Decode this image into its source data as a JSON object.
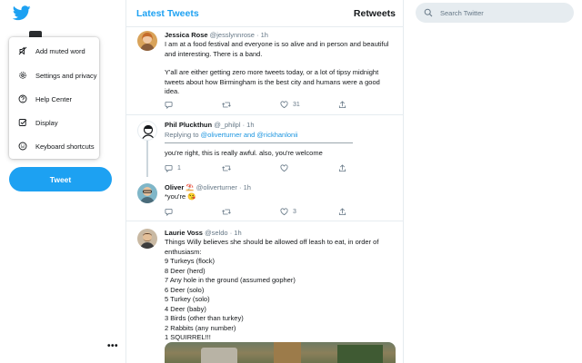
{
  "colors": {
    "accent": "#1da1f2",
    "link": "#1b95e0",
    "muted": "#657786",
    "border": "#e6ecf0"
  },
  "nav": {
    "logo_icon": "twitter-bird-icon",
    "menu": [
      {
        "label": "Add muted word",
        "icon": "mute-icon"
      },
      {
        "label": "Settings and privacy",
        "icon": "gear-icon"
      },
      {
        "label": "Help Center",
        "icon": "help-icon"
      },
      {
        "label": "Display",
        "icon": "display-icon"
      },
      {
        "label": "Keyboard shortcuts",
        "icon": "keyboard-icon"
      }
    ],
    "tweet_button": "Tweet",
    "more": "•••"
  },
  "header": {
    "title": "Latest Tweets",
    "retweets": "Retweets"
  },
  "search": {
    "placeholder": "Search Twitter"
  },
  "tweets": [
    {
      "name": "Jessica Rose",
      "handle": "@jesslynnrose · 1h",
      "text_p1": "I am at a food festival and everyone is so alive and in person and beautiful and interesting. There is a band.",
      "text_p2": "Y'all are either getting zero more tweets today, or a lot of tipsy midnight tweets about how Birmingham is the best city and humans were a good idea.",
      "likes": "31"
    },
    {
      "name": "Phil Pluckthun",
      "handle": "@_philpl · 1h",
      "replying_prefix": "Replying to ",
      "replying_to": "@oliverturner and @rickhanlonii",
      "text": "you're right, this is really awful. also, you're welcome",
      "replies": "1"
    },
    {
      "name": "Oliver ⛱️",
      "handle": "@oliverturner · 1h",
      "text": "*you're 😘",
      "likes": "3"
    },
    {
      "name": "Laurie Voss",
      "handle": "@seldo · 1h",
      "lines": [
        "Things Willy believes she should be allowed off leash to eat, in order of",
        "enthusiasm:",
        "9 Turkeys (flock)",
        "8 Deer (herd)",
        "7 Any hole in the ground (assumed gopher)",
        "6 Deer (solo)",
        "5 Turkey (solo)",
        "4 Deer (baby)",
        "3 Birds (other than turkey)",
        "2 Rabbits (any number)",
        "1 SQUIRREL!!!"
      ]
    }
  ]
}
